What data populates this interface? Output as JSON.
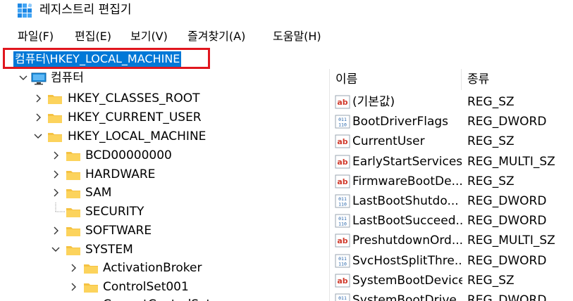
{
  "window": {
    "title": "레지스트리 편집기",
    "icon": "registry-editor-icon"
  },
  "menu": {
    "file": "파일(F)",
    "edit": "편집(E)",
    "view": "보기(V)",
    "favorites": "즐겨찾기(A)",
    "help": "도움말(H)"
  },
  "address": {
    "path": "컴퓨터\\HKEY_LOCAL_MACHINE"
  },
  "tree": {
    "computer": "컴퓨터",
    "hkcr": "HKEY_CLASSES_ROOT",
    "hkcu": "HKEY_CURRENT_USER",
    "hklm": "HKEY_LOCAL_MACHINE",
    "bcd": "BCD00000000",
    "hardware": "HARDWARE",
    "sam": "SAM",
    "security": "SECURITY",
    "software": "SOFTWARE",
    "system": "SYSTEM",
    "activation_broker": "ActivationBroker",
    "controlset001": "ControlSet001",
    "current_control_set": "CurrentControlSet"
  },
  "list": {
    "col_name": "이름",
    "col_type": "종류",
    "rows": [
      {
        "name": "(기본값)",
        "type": "REG_SZ",
        "kind": "string"
      },
      {
        "name": "BootDriverFlags",
        "type": "REG_DWORD",
        "kind": "binary"
      },
      {
        "name": "CurrentUser",
        "type": "REG_SZ",
        "kind": "string"
      },
      {
        "name": "EarlyStartServices",
        "type": "REG_MULTI_SZ",
        "kind": "string"
      },
      {
        "name": "FirmwareBootDe...",
        "type": "REG_SZ",
        "kind": "string"
      },
      {
        "name": "LastBootShutdo...",
        "type": "REG_DWORD",
        "kind": "binary"
      },
      {
        "name": "LastBootSucceed...",
        "type": "REG_DWORD",
        "kind": "binary"
      },
      {
        "name": "PreshutdownOrd...",
        "type": "REG_MULTI_SZ",
        "kind": "string"
      },
      {
        "name": "SvcHostSplitThre...",
        "type": "REG_DWORD",
        "kind": "binary"
      },
      {
        "name": "SystemBootDevice",
        "type": "REG_SZ",
        "kind": "string"
      },
      {
        "name": "SystemBootDrive...",
        "type": "REG_DWORD",
        "kind": "binary"
      }
    ]
  },
  "colors": {
    "highlight_border": "#e0161e",
    "selection": "#0078d7",
    "folder": "#f5c242"
  }
}
